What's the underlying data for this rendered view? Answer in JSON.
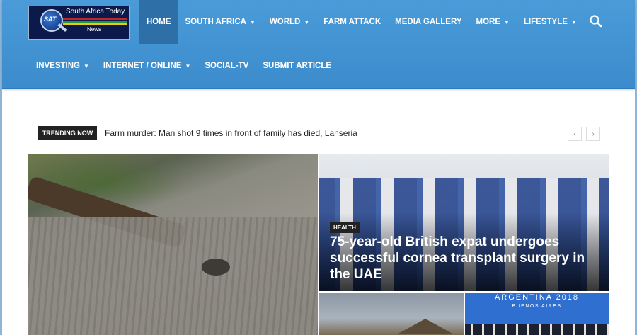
{
  "header": {
    "logo": {
      "line1": "South Africa Today",
      "line2": "News",
      "badge": "SAT"
    },
    "nav_primary": [
      {
        "label": "HOME",
        "active": true,
        "dropdown": false
      },
      {
        "label": "SOUTH AFRICA",
        "dropdown": true
      },
      {
        "label": "WORLD",
        "dropdown": true
      },
      {
        "label": "FARM ATTACK",
        "dropdown": false
      },
      {
        "label": "MEDIA GALLERY",
        "dropdown": false
      },
      {
        "label": "MORE",
        "dropdown": true
      },
      {
        "label": "LIFESTYLE",
        "dropdown": true
      }
    ],
    "nav_secondary": [
      {
        "label": "INVESTING",
        "dropdown": true
      },
      {
        "label": "INTERNET / ONLINE",
        "dropdown": true
      },
      {
        "label": "SOCIAL-TV",
        "dropdown": false
      },
      {
        "label": "SUBMIT ARTICLE",
        "dropdown": false
      }
    ],
    "search_icon": "search-icon"
  },
  "trending": {
    "label": "TRENDING NOW",
    "headline": "Farm murder: Man shot 9 times in front of family has died, Lanseria",
    "prev": "‹",
    "next": "›"
  },
  "tiles": {
    "big": {
      "image": "elephant close-up"
    },
    "health": {
      "category": "HEALTH",
      "title": "75-year-old British expat undergoes successful cornea transplant surgery in the UAE"
    },
    "house": {
      "image": "house roof"
    },
    "argentina": {
      "line1": "ARGENTINA 2018",
      "line2": "BUENOS AIRES"
    }
  },
  "colors": {
    "header": "#4a9bd8",
    "active_nav": "#2f6fa8",
    "badge": "#222222"
  }
}
